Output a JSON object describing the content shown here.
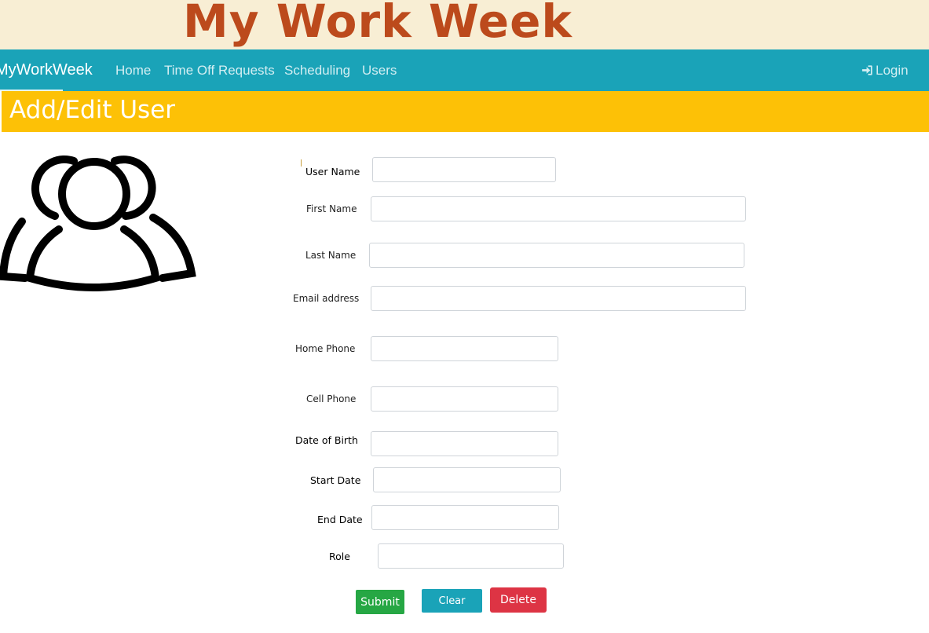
{
  "banner": {
    "title": "My Work Week"
  },
  "navbar": {
    "brand": "MyWorkWeek",
    "links": [
      "Home",
      "Time Off Requests",
      "Scheduling",
      "Users"
    ],
    "login": "Login"
  },
  "page": {
    "heading": "Add/Edit User"
  },
  "form": {
    "fields": [
      {
        "label": "User Name",
        "value": ""
      },
      {
        "label": "First Name",
        "value": ""
      },
      {
        "label": "Last Name",
        "value": ""
      },
      {
        "label": "Email address",
        "value": ""
      },
      {
        "label": "Home Phone",
        "value": ""
      },
      {
        "label": "Cell Phone",
        "value": ""
      },
      {
        "label": "Date of Birth",
        "value": ""
      },
      {
        "label": "Start Date",
        "value": ""
      },
      {
        "label": "End Date",
        "value": ""
      },
      {
        "label": "Role",
        "value": ""
      }
    ],
    "buttons": {
      "submit": "Submit",
      "clear": "Clear",
      "delete": "Delete"
    }
  },
  "icons": {
    "users": "users-icon",
    "login": "sign-in-icon"
  },
  "colors": {
    "banner_bg": "#f8eed4",
    "banner_text": "#bc4a1c",
    "navbar": "#1aa3b8",
    "heading_bar": "#fdc106",
    "submit": "#26a744",
    "clear": "#1aa3b8",
    "delete": "#dd3444"
  }
}
